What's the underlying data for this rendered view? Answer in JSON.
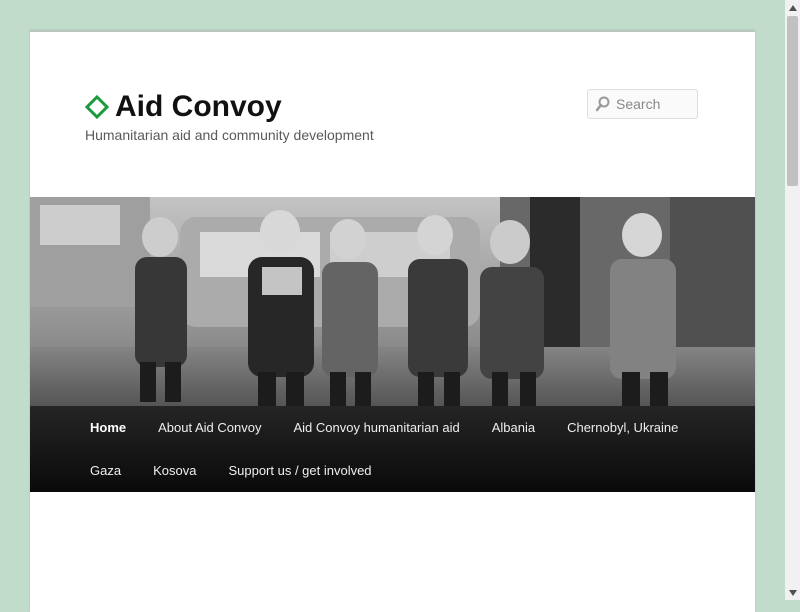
{
  "site": {
    "title": "Aid Convoy",
    "tagline": "Humanitarian aid and community development",
    "accent_color": "#1a9a3a"
  },
  "search": {
    "placeholder": "Search",
    "icon": "search-icon"
  },
  "banner": {
    "description_icon": "header-photo"
  },
  "nav": {
    "items": [
      {
        "label": "Home",
        "active": true
      },
      {
        "label": "About Aid Convoy"
      },
      {
        "label": "Aid Convoy humanitarian aid"
      },
      {
        "label": "Albania"
      },
      {
        "label": "Chernobyl, Ukraine"
      },
      {
        "label": "Gaza"
      },
      {
        "label": "Kosova"
      },
      {
        "label": "Support us / get involved"
      }
    ]
  },
  "colors": {
    "background": "#c1dccb",
    "nav_background": "#1a1a1a"
  }
}
